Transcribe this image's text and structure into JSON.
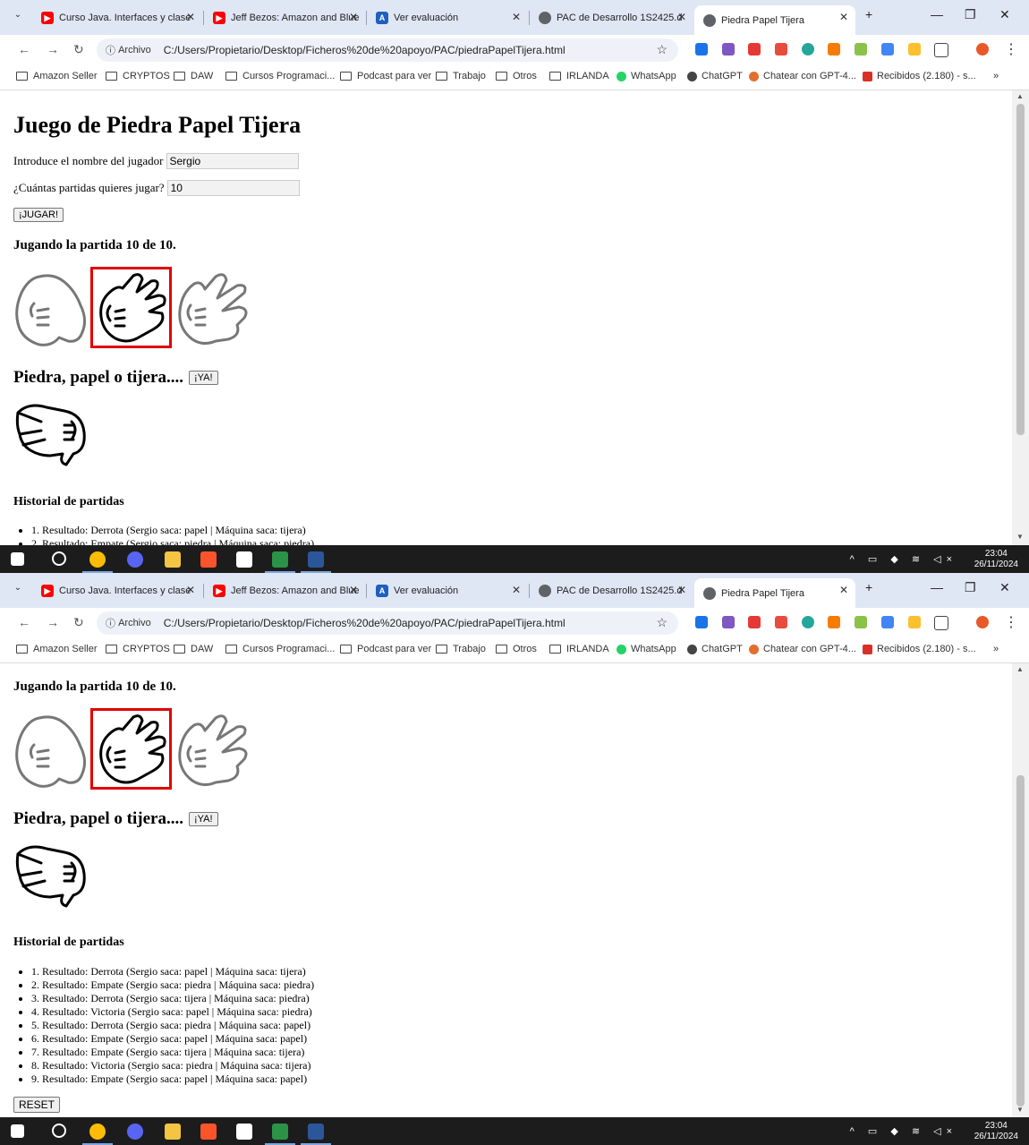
{
  "tabs": [
    {
      "label": "Curso Java. Interfaces y clase",
      "icon": "youtube-icon",
      "color": "#ff0000"
    },
    {
      "label": "Jeff Bezos: Amazon and Blue",
      "icon": "youtube-icon",
      "color": "#ff0000"
    },
    {
      "label": "Ver evaluación",
      "icon": "app-icon",
      "color": "#1f5fbf"
    },
    {
      "label": "PAC de Desarrollo 1S2425.d",
      "icon": "globe-icon",
      "color": "#5f6368"
    },
    {
      "label": "Piedra Papel Tijera",
      "icon": "globe-icon",
      "color": "#5f6368"
    }
  ],
  "address": {
    "chip": "Archivo",
    "url": "C:/Users/Propietario/Desktop/Ficheros%20de%20apoyo/PAC/piedraPapelTijera.html"
  },
  "bookmarks": [
    {
      "label": "Amazon Seller",
      "kind": "folder"
    },
    {
      "label": "CRYPTOS",
      "kind": "folder"
    },
    {
      "label": "DAW",
      "kind": "folder"
    },
    {
      "label": "Cursos Programaci...",
      "kind": "folder"
    },
    {
      "label": "Podcast para ver",
      "kind": "folder"
    },
    {
      "label": "Trabajo",
      "kind": "folder"
    },
    {
      "label": "Otros",
      "kind": "folder"
    },
    {
      "label": "IRLANDA",
      "kind": "folder"
    },
    {
      "label": "WhatsApp",
      "kind": "site",
      "color": "#25d366"
    },
    {
      "label": "ChatGPT",
      "kind": "site",
      "color": "#444444"
    },
    {
      "label": "Chatear con GPT-4...",
      "kind": "site",
      "color": "#e36f2c"
    },
    {
      "label": "Recibidos (2.180) - s...",
      "kind": "site",
      "color": "#d93025"
    }
  ],
  "bookmarks_more": "»",
  "page": {
    "title": "Juego de Piedra Papel Tijera",
    "name_label": "Introduce el nombre del jugador",
    "name_value": "Sergio",
    "games_label": "¿Cuántas partidas quieres jugar?",
    "games_value": "10",
    "play_button": "¡JUGAR!",
    "status": "Jugando la partida 10 de 10.",
    "prompt": "Piedra, papel o tijera....",
    "go_button": "¡YA!",
    "history_title": "Historial de partidas",
    "history": [
      "1. Resultado: Derrota (Sergio saca: papel | Máquina saca: tijera)",
      "2. Resultado: Empate (Sergio saca: piedra | Máquina saca: piedra)",
      "3. Resultado: Derrota (Sergio saca: tijera | Máquina saca: piedra)",
      "4. Resultado: Victoria (Sergio saca: papel | Máquina saca: piedra)",
      "5. Resultado: Derrota (Sergio saca: piedra | Máquina saca: papel)",
      "6. Resultado: Empate (Sergio saca: papel | Máquina saca: papel)",
      "7. Resultado: Empate (Sergio saca: tijera | Máquina saca: tijera)",
      "8. Resultado: Victoria (Sergio saca: piedra | Máquina saca: tijera)",
      "9. Resultado: Empate (Sergio saca: papel | Máquina saca: papel)"
    ],
    "reset_button": "RESET",
    "selected_hand": "papel"
  },
  "taskbar": {
    "time": "23:04",
    "date": "26/11/2024"
  },
  "colors": {
    "selection": "#e00000",
    "tabstrip": "#dfe7f5"
  }
}
